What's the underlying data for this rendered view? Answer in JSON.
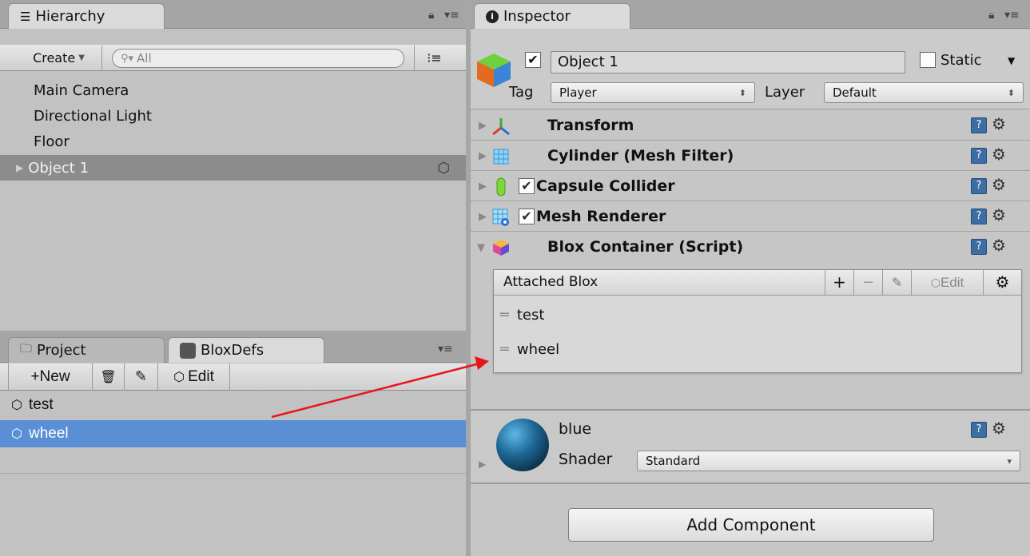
{
  "hierarchy": {
    "tab_label": "Hierarchy",
    "create_label": "Create",
    "search_placeholder": "All",
    "items": [
      "Main Camera",
      "Directional Light",
      "Floor"
    ],
    "selected_item": "Object 1"
  },
  "project": {
    "tab_label": "Project",
    "bloxdefs_tab_label": "BloxDefs",
    "new_label": "+New",
    "edit_label": "Edit",
    "items": [
      "test"
    ],
    "selected_item": "wheel"
  },
  "inspector": {
    "tab_label": "Inspector",
    "object_name": "Object 1",
    "static_label": "Static",
    "tag_label": "Tag",
    "tag_value": "Player",
    "layer_label": "Layer",
    "layer_value": "Default",
    "components": [
      {
        "name": "Transform",
        "icon": "transform-icon"
      },
      {
        "name": "Cylinder (Mesh Filter)",
        "icon": "mesh-filter-icon"
      },
      {
        "name": "Capsule Collider",
        "icon": "capsule-collider-icon",
        "checkbox": true
      },
      {
        "name": "Mesh Renderer",
        "icon": "mesh-renderer-icon",
        "checkbox": true
      },
      {
        "name": "Blox Container (Script)",
        "icon": "blox-container-icon",
        "expanded": true
      }
    ],
    "attached_blox": {
      "header": "Attached Blox",
      "add": "+",
      "remove": "−",
      "edit_label": "Edit",
      "items": [
        "test",
        "wheel"
      ]
    },
    "material": {
      "name": "blue",
      "shader_label": "Shader",
      "shader_value": "Standard"
    },
    "add_component_label": "Add Component"
  },
  "colors": {
    "selection_blue": "#5a8fd6",
    "hierarchy_selection": "#8a8a8a",
    "annotation_arrow": "#e8161b",
    "help_icon": "#3d6ea3"
  }
}
